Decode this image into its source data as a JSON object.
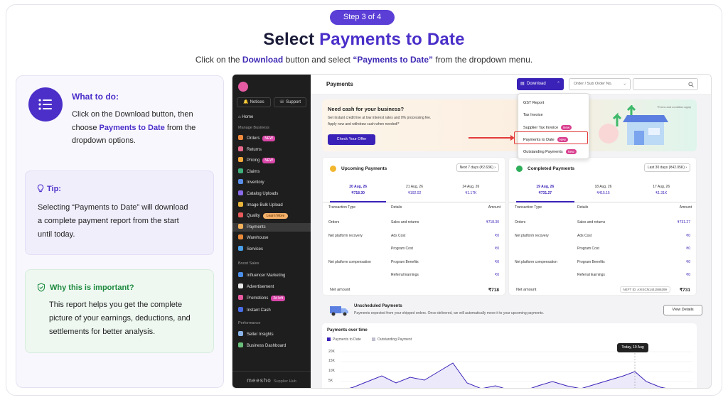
{
  "header": {
    "step": "Step 3 of 4",
    "title_part1": "Select",
    "title_part2": "Payments to Date",
    "subtitle_pre": "Click on the ",
    "subtitle_b1": "Download",
    "subtitle_mid": " button and select ",
    "subtitle_b2": "“Payments to Date”",
    "subtitle_post": " from the dropdown menu."
  },
  "what": {
    "heading": "What to do:",
    "line1": "Click on the Download button, then choose ",
    "highlight": "Payments to Date",
    "line2": " from the dropdown options."
  },
  "tip": {
    "heading": "Tip:",
    "text": "Selecting “Payments to Date” will download a complete payment report from the start until today."
  },
  "why": {
    "heading": "Why this is important?",
    "text": "This report helps you get the complete picture of your earnings, deductions, and settlements for better analysis."
  },
  "sidebar": {
    "notices": "Notices",
    "support": "Support",
    "home": "Home",
    "section_manage": "Manage Business",
    "items": [
      {
        "label": "Orders",
        "badge": "NEW",
        "color": "#f08a3c"
      },
      {
        "label": "Returns",
        "color": "#e86a8c"
      },
      {
        "label": "Pricing",
        "badge": "NEW",
        "color": "#f2a93b"
      },
      {
        "label": "Claims",
        "color": "#3fb07a"
      },
      {
        "label": "Inventory",
        "color": "#5a8ee8"
      },
      {
        "label": "Catalog Uploads",
        "color": "#8a6ae8"
      },
      {
        "label": "Image Bulk Upload",
        "color": "#e8b43a"
      },
      {
        "label": "Quality",
        "badge": "Learn More",
        "color": "#e85a5a"
      },
      {
        "label": "Payments",
        "color": "#f2b15a"
      },
      {
        "label": "Warehouse",
        "color": "#e8893a"
      },
      {
        "label": "Services",
        "color": "#4aa0e8"
      }
    ],
    "section_boost": "Boost Sales",
    "boost": [
      {
        "label": "Influencer Marketing",
        "color": "#4a8ee8"
      },
      {
        "label": "Advertisement",
        "color": "#e8e8e8"
      },
      {
        "label": "Promotions",
        "badge": "2d left",
        "color": "#e85aa0"
      },
      {
        "label": "Instant Cash",
        "color": "#4a6ee8"
      }
    ],
    "section_perf": "Performance",
    "perf": [
      {
        "label": "Seller Insights",
        "color": "#8ab4e8"
      },
      {
        "label": "Business Dashboard",
        "color": "#6ac07a"
      }
    ],
    "footer_brand": "meesho",
    "footer_sub": "Supplier Hub"
  },
  "topbar": {
    "title": "Payments",
    "download": "Download",
    "order_placeholder": "Order / Sub Order No."
  },
  "dropdown": {
    "items": [
      "GST Report",
      "Tax Invoice",
      "Supplier Tax Invoice",
      "Payments to Date",
      "Outstanding Payments"
    ],
    "new_label": "New"
  },
  "banner": {
    "heading": "Need cash for your business?",
    "line1": "Get instant credit line at low interest rates and 0% processing fee.",
    "line2": "Apply now and withdraw cash when needed!*",
    "button": "Check Your Offer",
    "note": "*Terms and condition apply"
  },
  "upcoming": {
    "title": "Upcoming Payments",
    "filter": "Next 7 days (₹2.63K)",
    "dates": [
      {
        "d": "20 Aug, 26",
        "a": "₹718.30"
      },
      {
        "d": "21 Aug, 26",
        "a": "₹192.02"
      },
      {
        "d": "24 Aug, 26",
        "a": "₹1.17K"
      }
    ],
    "cols": [
      "Transaction Type",
      "Details",
      "Amount"
    ],
    "rows": [
      {
        "t": "Orders",
        "d": "Sales and returns",
        "a": "₹718.30"
      },
      {
        "t": "Net platform recovery",
        "d": "Ads Cost",
        "a": "₹0"
      },
      {
        "t": "",
        "d": "Program Cost",
        "a": "₹0"
      },
      {
        "t": "Net platform compensation",
        "d": "Program Benefits",
        "a": "₹0"
      },
      {
        "t": "",
        "d": "Referral Earnings",
        "a": "₹0"
      }
    ],
    "net_label": "Net amount",
    "net_value": "₹718"
  },
  "completed": {
    "title": "Completed Payments",
    "filter": "Last 30 days (₹42.05K)",
    "dates": [
      {
        "d": "19 Aug, 26",
        "a": "₹731.27"
      },
      {
        "d": "18 Aug, 26",
        "a": "₹415.15"
      },
      {
        "d": "17 Aug, 26",
        "a": "₹1.31K"
      }
    ],
    "cols": [
      "Transaction Type",
      "Details",
      "Amount"
    ],
    "rows": [
      {
        "t": "Orders",
        "d": "Sales and returns",
        "a": "₹731.27"
      },
      {
        "t": "Net platform recovery",
        "d": "Ads Cost",
        "a": "₹0"
      },
      {
        "t": "",
        "d": "Program Cost",
        "a": "₹0"
      },
      {
        "t": "Net platform compensation",
        "d": "Program Benefits",
        "a": "₹0"
      },
      {
        "t": "",
        "d": "Referral Earnings",
        "a": "₹0"
      }
    ],
    "net_label": "Net amount",
    "neft": "NEFT ID: AXISCN1441586399",
    "net_value": "₹731"
  },
  "unscheduled": {
    "title": "Unscheduled Payments",
    "text": "Payments expected from your shipped orders. Once delivered, we will automatically move it to your upcoming payments.",
    "button": "View Details"
  },
  "chart": {
    "title": "Payments over time",
    "legend1": "Payments to Date",
    "legend2": "Outstanding Payment",
    "yticks": [
      "20K",
      "15K",
      "10K",
      "5K"
    ],
    "tooltip": "Today, 19 Aug"
  }
}
